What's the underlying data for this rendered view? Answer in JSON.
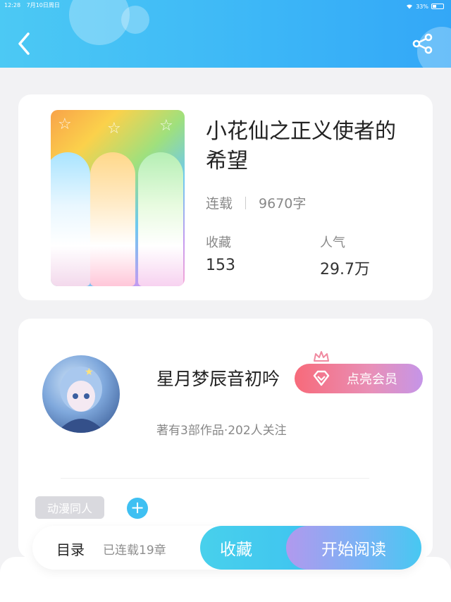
{
  "status_bar": {
    "time": "12:28",
    "date": "7月10日周日",
    "battery": "33%"
  },
  "header": {
    "back_icon": "chevron-left-icon",
    "share_icon": "share-icon"
  },
  "book": {
    "title": "小花仙之正义使者的希望",
    "status": "连载",
    "word_count": "9670字",
    "favorites_label": "收藏",
    "favorites_value": "153",
    "popularity_label": "人气",
    "popularity_value": "29.7万"
  },
  "author": {
    "name": "星月梦辰音初吟",
    "vip_button": "点亮会员",
    "subtitle": "著有3部作品·202人关注",
    "tag": "动漫同人",
    "add_tag": "+"
  },
  "bottom_bar": {
    "toc": "目录",
    "chapters": "已连载19章",
    "favorite": "收藏",
    "start_reading": "开始阅读"
  },
  "colors": {
    "header": "#3cb6f7",
    "accent": "#3fc0f2",
    "vip_start": "#f76a7a",
    "vip_end": "#c595e8"
  }
}
